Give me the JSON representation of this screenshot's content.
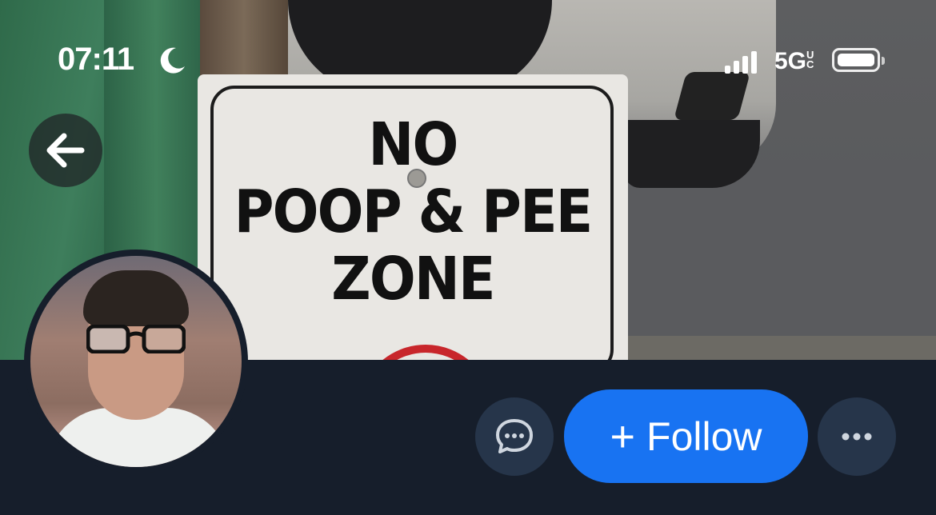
{
  "status_bar": {
    "time": "07:11",
    "network": "5G",
    "network_suffix_top": "U",
    "network_suffix_bottom": "C"
  },
  "banner": {
    "sign_lines": [
      "NO",
      "POOP & PEE",
      "ZONE"
    ]
  },
  "actions": {
    "follow_icon": "+",
    "follow_label": "Follow"
  },
  "icons": {
    "back": "arrow-left-icon",
    "message": "chat-bubble-icon",
    "more": "ellipsis-icon"
  },
  "colors": {
    "accent": "#1873f2",
    "background": "#161e2b",
    "icon_button": "#26354a"
  }
}
